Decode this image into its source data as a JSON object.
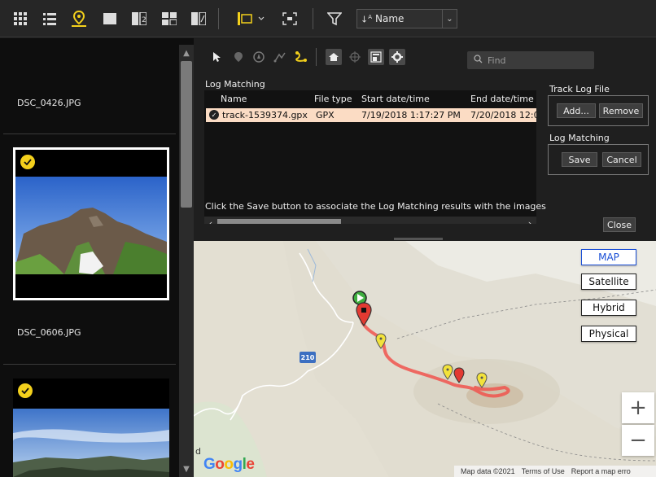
{
  "toolbar": {
    "icons": [
      "grid-view-icon",
      "list-view-icon",
      "map-pin-icon",
      "single-view-icon",
      "compare-2up-icon",
      "compare-4up-icon",
      "compare-before-after-icon",
      "filmstrip-layout-icon",
      "fullscreen-icon",
      "filter-icon",
      "sort-icon"
    ],
    "sort_value": "Name",
    "accent": "#f3d01c"
  },
  "browser": {
    "items": [
      {
        "label": "DSC_0426.JPG"
      },
      {
        "label": "DSC_0606.JPG"
      }
    ]
  },
  "panel": {
    "find_placeholder": "Find",
    "log_matching_title": "Log Matching",
    "columns": [
      "Name",
      "File type",
      "Start date/time",
      "End date/time"
    ],
    "rows": [
      {
        "name": "track-1539374.gpx",
        "file_type": "GPX",
        "start": "7/19/2018 1:17:27 PM",
        "end": "7/20/2018 12:0"
      }
    ],
    "message": "Click the Save button to associate the Log Matching results with the images",
    "track_log_group": {
      "title": "Track Log File",
      "add": "Add...",
      "remove": "Remove"
    },
    "log_matching_group": {
      "title": "Log Matching",
      "save": "Save",
      "cancel": "Cancel"
    },
    "close": "Close"
  },
  "map": {
    "types": [
      "MAP",
      "Satellite",
      "Hybrid",
      "Physical"
    ],
    "active_type": "MAP",
    "road_label": "210",
    "zoom_in": "+",
    "zoom_out": "−",
    "google": "Google",
    "footer": {
      "data": "Map data ©2021",
      "terms": "Terms of Use",
      "report": "Report a map erro"
    },
    "corner_letter": "d",
    "track_color": "#f0544d"
  }
}
